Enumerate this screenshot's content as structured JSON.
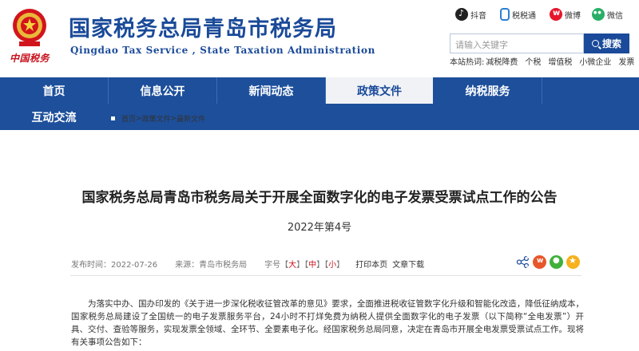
{
  "header": {
    "title": "国家税务总局青岛市税务局",
    "title_en": "Qingdao Tax Service , State Taxation Administration",
    "brand_sub": "中国税务",
    "social": [
      {
        "label": "抖音",
        "icon": "douyin-icon"
      },
      {
        "label": "税税通",
        "icon": "app-icon"
      },
      {
        "label": "微博",
        "icon": "weibo-icon"
      },
      {
        "label": "微信",
        "icon": "wechat-icon"
      }
    ],
    "search": {
      "placeholder": "请输入关键字",
      "button_label": "搜索"
    },
    "hot_label": "本站热词:",
    "hot_words": [
      "减税降费",
      "个税",
      "增值税",
      "小微企业",
      "发票"
    ]
  },
  "nav": {
    "items": [
      "首页",
      "信息公开",
      "新闻动态",
      "政策文件",
      "纳税服务",
      "互动交流"
    ],
    "active": "政策文件"
  },
  "breadcrumb": [
    "首页",
    "政策文件",
    "最新文件"
  ],
  "article": {
    "title": "国家税务总局青岛市税务局关于开展全面数字化的电子发票受票试点工作的公告",
    "doc_no": "2022年第4号",
    "meta": {
      "date": "发布时间：2022-07-26",
      "source": "来源：青岛市税务局",
      "font_size_label": "字号",
      "sizes": [
        "大",
        "中",
        "小"
      ],
      "print": "打印本页",
      "download": "文章下载"
    },
    "paragraph": "为落实中办、国办印发的《关于进一步深化税收征管改革的意见》要求，全面推进税收征管数字化升级和智能化改造，降低征纳成本，国家税务总局建设了全国统一的电子发票服务平台，24小时不打烊免费为纳税人提供全面数字化的电子发票（以下简称“全电发票”）开具、交付、查验等服务，实现发票全领域、全环节、全要素电子化。经国家税务总局同意，决定在青岛市开展全电发票受票试点工作。现将有关事项公告如下："
  },
  "colors": {
    "brand_blue": "#1a4a99",
    "nav_blue": "#1d4f9b",
    "accent_red": "#c8101b"
  }
}
